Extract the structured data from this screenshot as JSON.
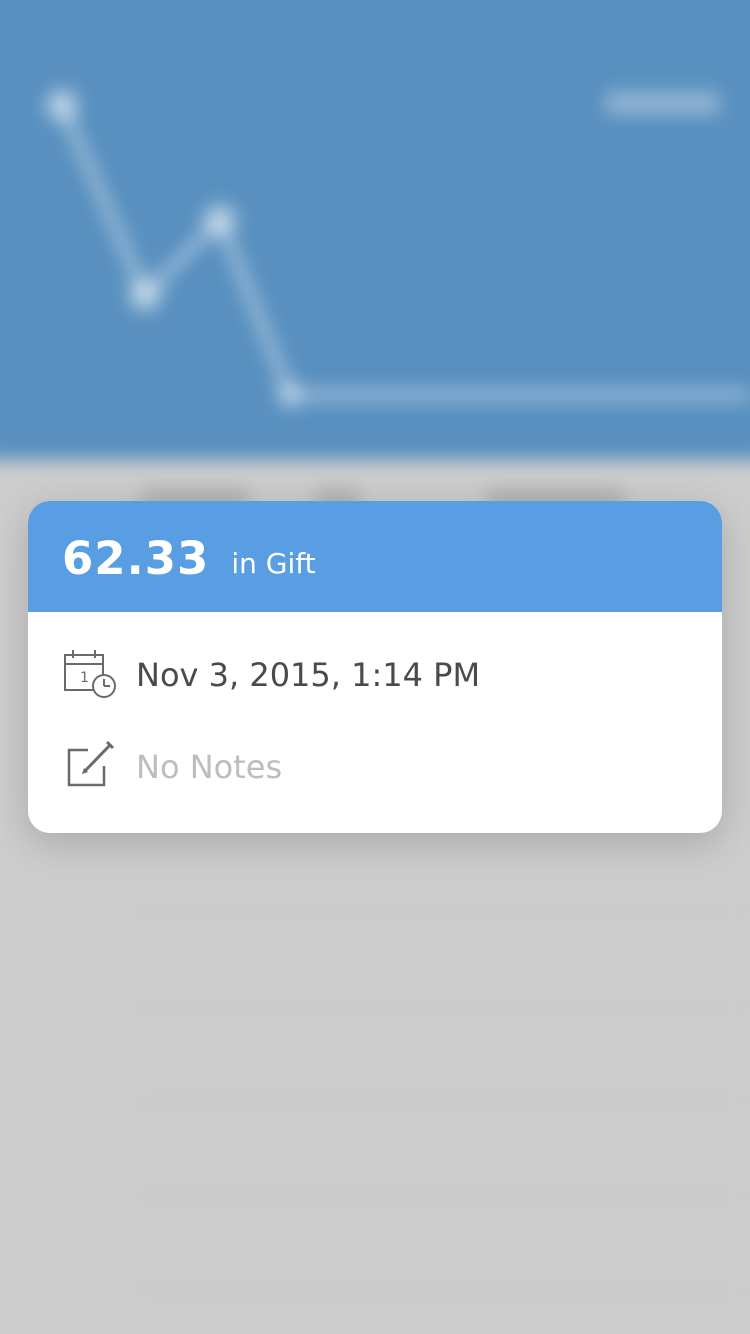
{
  "peek_card": {
    "amount": "62.33",
    "category": "in Gift",
    "date_time": "Nov 3, 2015, 1:14 PM",
    "calendar_icon_day": "1",
    "notes_placeholder": "No Notes",
    "icons": {
      "date": "calendar-clock-icon",
      "notes": "edit-note-icon"
    }
  },
  "colors": {
    "header_accent": "#599ee3",
    "background_header": "#5990bf",
    "card_background": "#ffffff",
    "primary_text": "#4a4a4a",
    "placeholder_text": "#bdbdbd",
    "dimmed_background": "#cdcdcd"
  }
}
